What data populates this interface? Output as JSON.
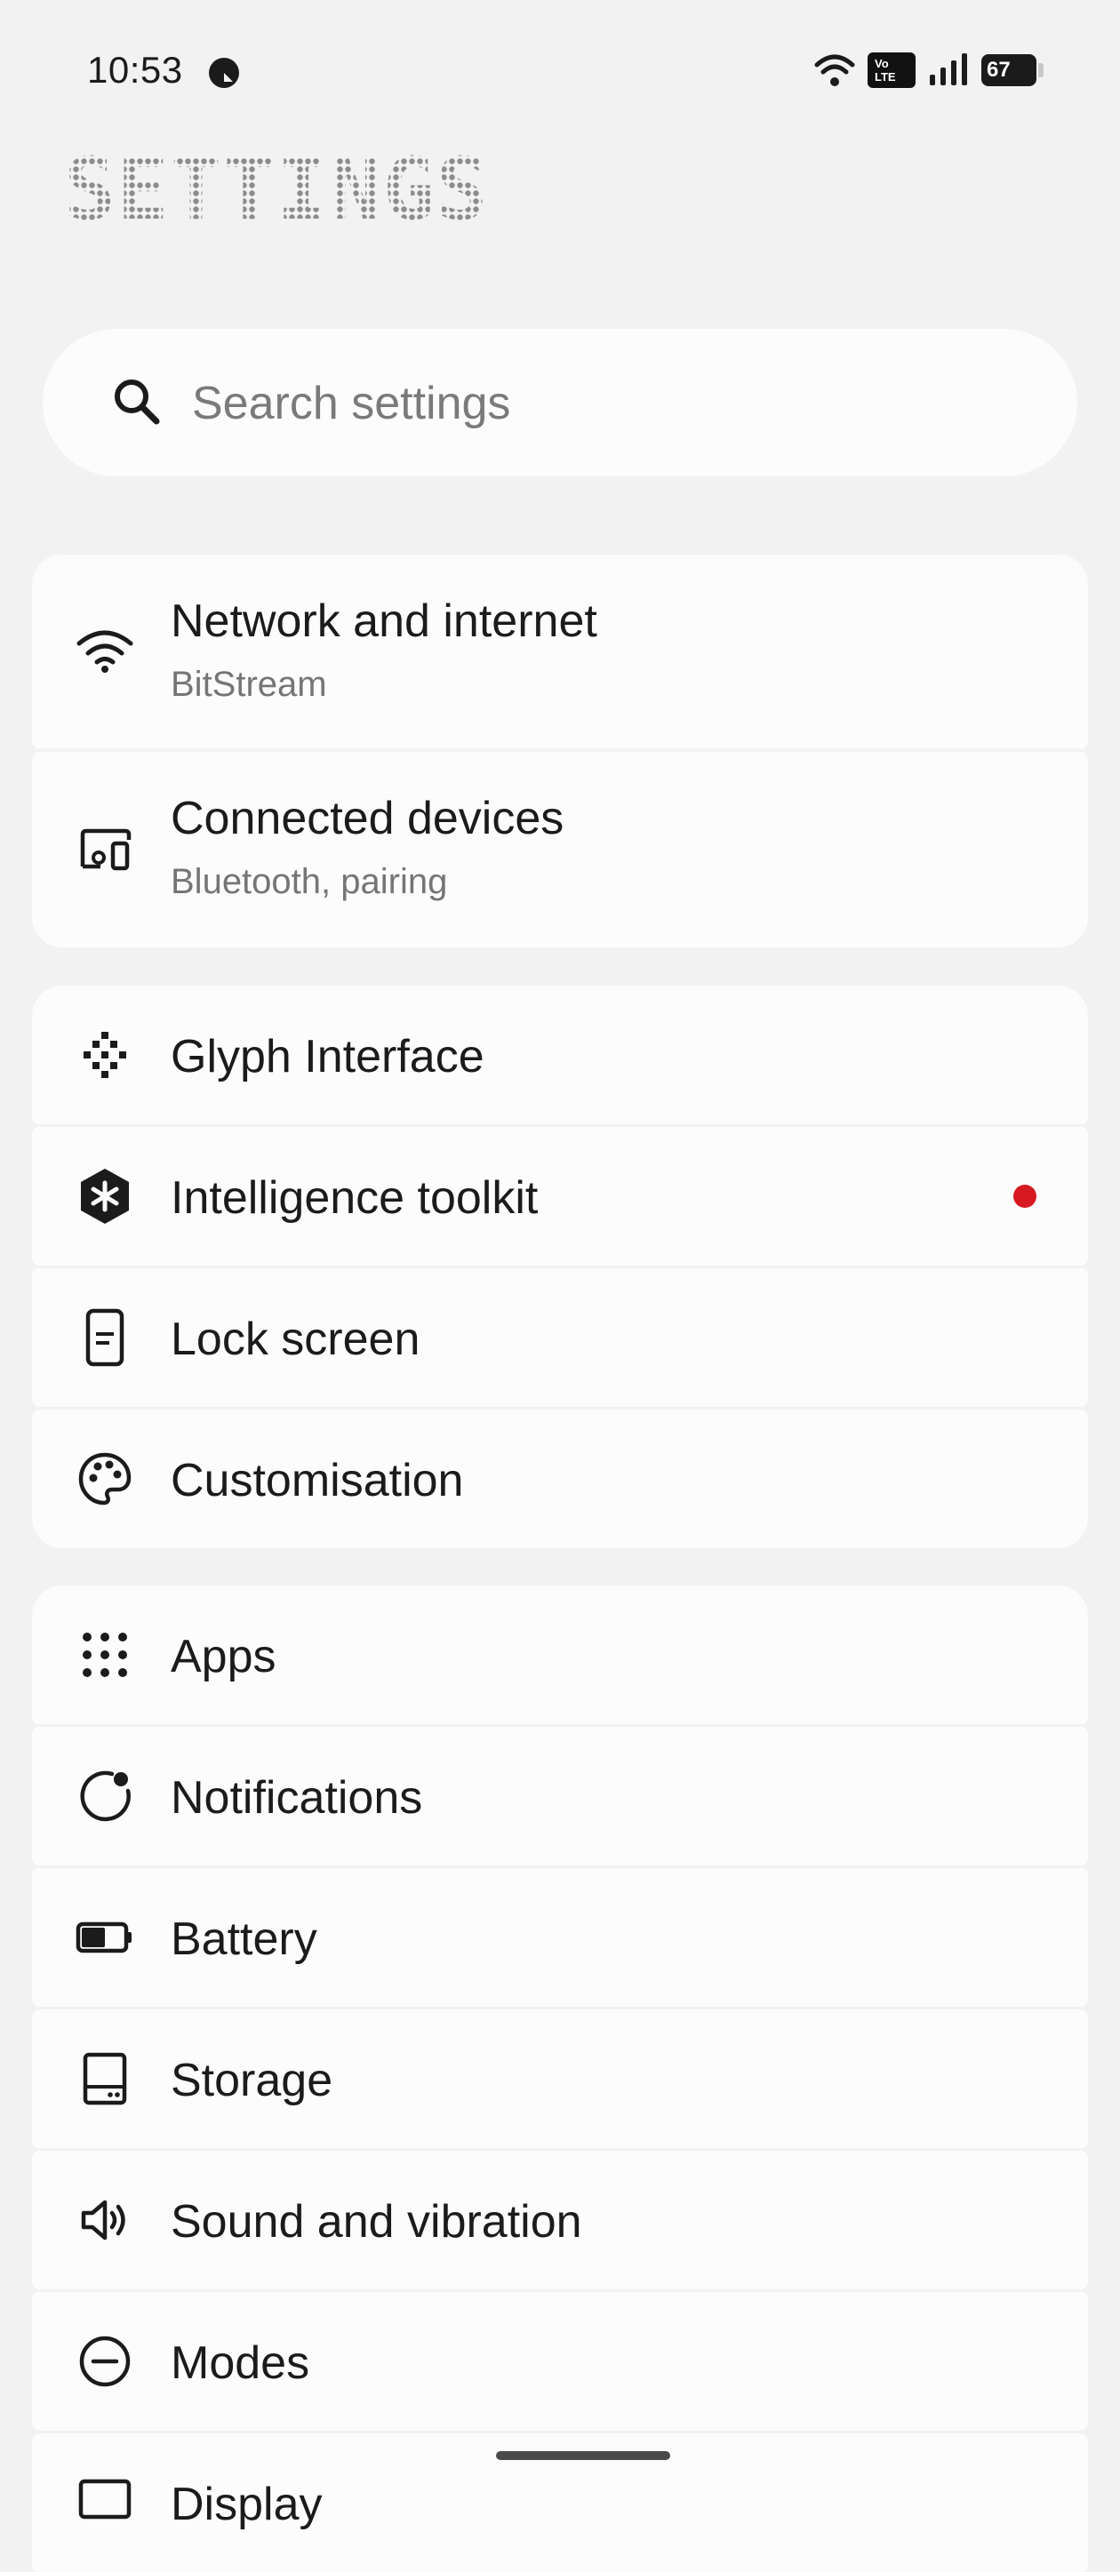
{
  "status_bar": {
    "time": "10:53",
    "network_badge_line1": "Vo",
    "network_badge_line2": "LTE",
    "battery_level": "67"
  },
  "page": {
    "title": "SETTINGS"
  },
  "search": {
    "placeholder": "Search settings"
  },
  "groups": [
    {
      "items": [
        {
          "title": "Network and internet",
          "subtitle": "BitStream",
          "icon": "wifi-icon"
        },
        {
          "title": "Connected devices",
          "subtitle": "Bluetooth, pairing",
          "icon": "connected-devices-icon"
        }
      ]
    },
    {
      "items": [
        {
          "title": "Glyph Interface",
          "icon": "glyph-icon"
        },
        {
          "title": "Intelligence toolkit",
          "icon": "intelligence-icon",
          "badge": true
        },
        {
          "title": "Lock screen",
          "icon": "lock-screen-icon"
        },
        {
          "title": "Customisation",
          "icon": "palette-icon"
        }
      ]
    },
    {
      "items": [
        {
          "title": "Apps",
          "icon": "apps-grid-icon"
        },
        {
          "title": "Notifications",
          "icon": "notifications-icon"
        },
        {
          "title": "Battery",
          "icon": "battery-icon"
        },
        {
          "title": "Storage",
          "icon": "storage-icon"
        },
        {
          "title": "Sound and vibration",
          "icon": "sound-icon"
        },
        {
          "title": "Modes",
          "icon": "modes-icon"
        },
        {
          "title": "Display",
          "icon": "display-icon"
        }
      ]
    }
  ],
  "colors": {
    "background": "#f2f2f2",
    "card": "#fcfcfc",
    "accent_red": "#d71921",
    "text": "#1b1b1b",
    "secondary_text": "#757575"
  }
}
